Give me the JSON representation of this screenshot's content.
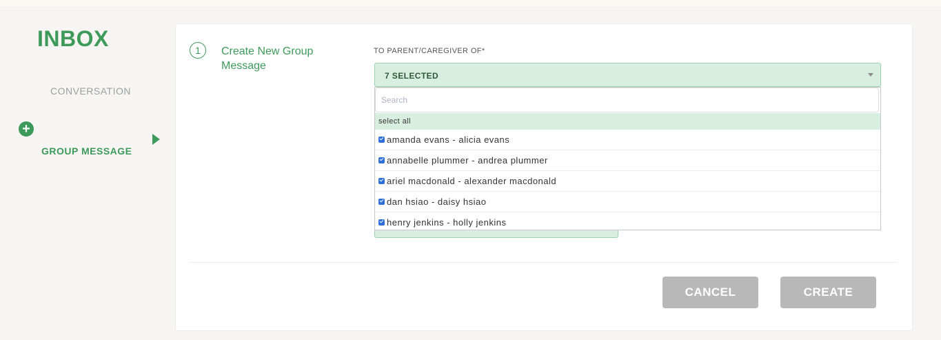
{
  "sidebar": {
    "title": "INBOX",
    "conversation_label": "CONVERSATION",
    "group_message_label": "GROUP MESSAGE"
  },
  "form": {
    "step_number": "1",
    "step_label": "Create New Group Message",
    "field_label": "TO PARENT/CAREGIVER OF*",
    "selected_value": "7 SELECTED",
    "search_placeholder": "Search",
    "select_all_label": "select all",
    "options": [
      {
        "label": "amanda evans - alicia evans",
        "checked": true
      },
      {
        "label": "annabelle plummer - andrea plummer",
        "checked": true
      },
      {
        "label": "ariel macdonald - alexander macdonald",
        "checked": true
      },
      {
        "label": "dan hsiao - daisy hsiao",
        "checked": true
      },
      {
        "label": "henry jenkins - holly jenkins",
        "checked": true
      }
    ]
  },
  "actions": {
    "cancel_label": "CANCEL",
    "create_label": "CREATE"
  },
  "colors": {
    "brand_green": "#3e9a5b",
    "selection_bg": "#d8eee0",
    "button_disabled": "#b8b8b8"
  }
}
